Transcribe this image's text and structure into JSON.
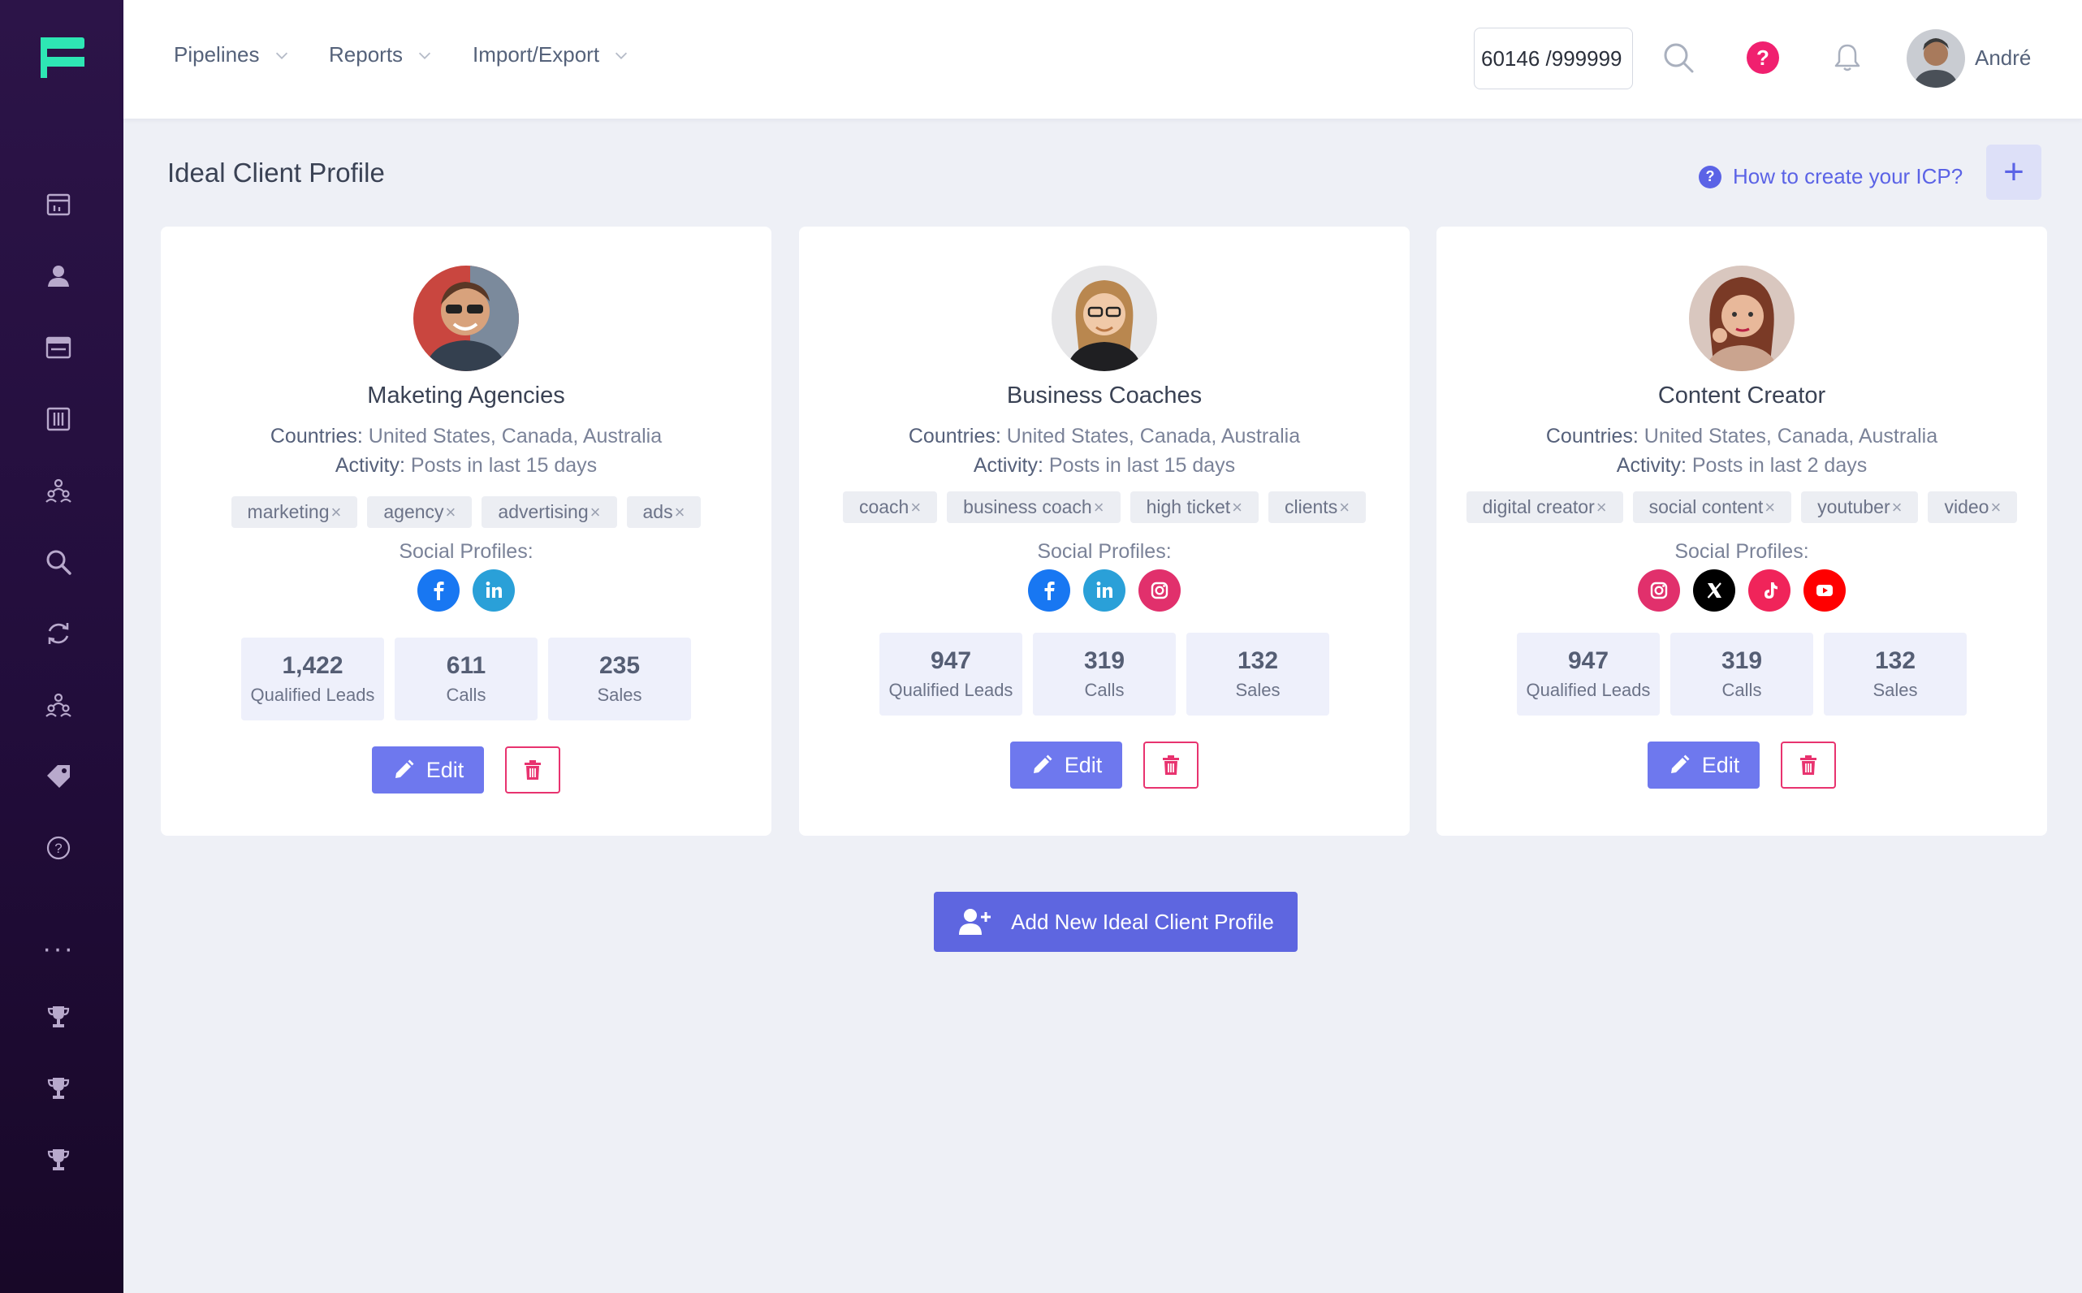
{
  "nav": {
    "menus": [
      "Pipelines",
      "Reports",
      "Import/Export"
    ],
    "search_value": "60146 /999999",
    "help_glyph": "?",
    "user_name": "André"
  },
  "sidebar_icons": [
    "dashboard-icon",
    "contacts-icon",
    "browser-icon",
    "columns-icon",
    "team-icon",
    "search-icon",
    "sync-icon",
    "team-icon",
    "tag-icon",
    "help-icon",
    "more-icon",
    "trophy-icon",
    "trophy-icon",
    "trophy-icon"
  ],
  "page": {
    "title": "Ideal Client Profile",
    "help_link": "How to create your ICP?",
    "add_icon": "+",
    "add_new_label": "Add New Ideal Client Profile"
  },
  "labels": {
    "countries": "Countries:",
    "activity": "Activity:",
    "social_profiles": "Social Profiles:",
    "edit": "Edit",
    "tag_remove": "×"
  },
  "profiles": [
    {
      "name": "Maketing Agencies",
      "countries": "United States, Canada, Australia",
      "activity": "Posts in last 15 days",
      "tags": [
        "marketing",
        "agency",
        "advertising",
        "ads"
      ],
      "socials": [
        "facebook",
        "linkedin"
      ],
      "stats": [
        {
          "value": "1,422",
          "label": "Qualified Leads"
        },
        {
          "value": "611",
          "label": "Calls"
        },
        {
          "value": "235",
          "label": "Sales"
        }
      ]
    },
    {
      "name": "Business Coaches",
      "countries": "United States, Canada, Australia",
      "activity": "Posts in last 15 days",
      "tags": [
        "coach",
        "business coach",
        "high ticket",
        "clients"
      ],
      "socials": [
        "facebook",
        "linkedin",
        "instagram"
      ],
      "stats": [
        {
          "value": "947",
          "label": "Qualified Leads"
        },
        {
          "value": "319",
          "label": "Calls"
        },
        {
          "value": "132",
          "label": "Sales"
        }
      ]
    },
    {
      "name": "Content Creator",
      "countries": "United States, Canada, Australia",
      "activity": "Posts in last 2 days",
      "tags": [
        "digital creator",
        "social content",
        "youtuber",
        "video"
      ],
      "socials": [
        "instagram",
        "x",
        "tiktok",
        "youtube"
      ],
      "stats": [
        {
          "value": "947",
          "label": "Qualified Leads"
        },
        {
          "value": "319",
          "label": "Calls"
        },
        {
          "value": "132",
          "label": "Sales"
        }
      ]
    }
  ],
  "colors": {
    "sidebar": "#2c1448",
    "accent": "#5e66e0",
    "danger": "#e8336f",
    "logo": "#2ee6b4",
    "facebook": "#1877f2",
    "linkedin": "#2aa0d8",
    "instagram": "#e1306c",
    "x": "#000000",
    "tiktok": "#f0245a",
    "youtube": "#ff0000"
  }
}
